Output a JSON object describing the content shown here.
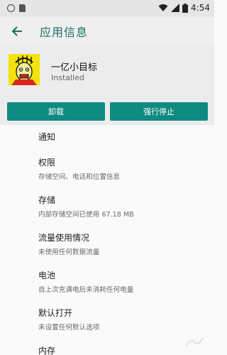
{
  "status_bar": {
    "time": "4:54",
    "icons": [
      "circle-icon",
      "sd-card-icon",
      "wifi-icon",
      "signal-icon",
      "battery-icon"
    ]
  },
  "app_bar": {
    "title": "应用信息",
    "back_icon": "arrow-back-icon"
  },
  "app": {
    "name": "一亿小目标",
    "status": "Installed",
    "icon": "app-meme-face-icon"
  },
  "actions": {
    "uninstall": "卸载",
    "force_stop": "强行停止"
  },
  "settings": {
    "notifications": {
      "title": "通知"
    },
    "permissions": {
      "title": "权限",
      "subtitle": "存储空间、电话和位置信息"
    },
    "storage": {
      "title": "存储",
      "subtitle": "内部存储空间已使用 67.18 MB"
    },
    "data_usage": {
      "title": "流量使用情况",
      "subtitle": "未使用任何数据流量"
    },
    "battery": {
      "title": "电池",
      "subtitle": "自上次充满电后未消耗任何电量"
    },
    "open_by_default": {
      "title": "默认打开",
      "subtitle": "未设置任何默认选项"
    },
    "memory": {
      "title": "内存"
    }
  },
  "colors": {
    "accent": "#0f8a80",
    "title_text": "#1a6f66",
    "header_bg": "#ececec"
  }
}
